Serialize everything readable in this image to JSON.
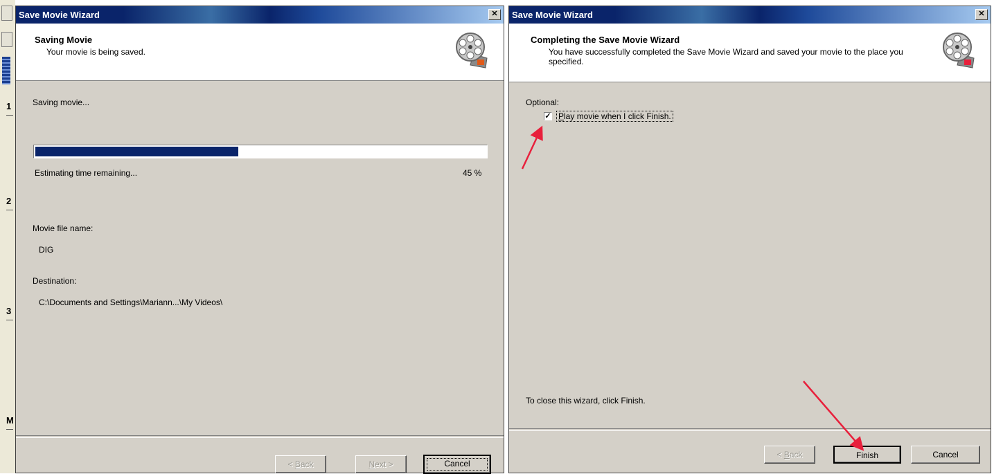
{
  "background_app": {
    "markers": [
      "1",
      "2",
      "3",
      "M"
    ]
  },
  "dialog_saving": {
    "title": "Save Movie Wizard",
    "close_glyph": "✕",
    "header_title": "Saving Movie",
    "header_subtitle": "Your movie is being saved.",
    "status_text": "Saving movie...",
    "progress_fraction": 0.45,
    "estimating_text": "Estimating time remaining...",
    "percent_text": "45 %",
    "file_name_label": "Movie file name:",
    "file_name_value": "DIG",
    "destination_label": "Destination:",
    "destination_value": "C:\\Documents and Settings\\Mariann...\\My Videos\\",
    "buttons": {
      "back_prefix": "< ",
      "back_accel": "B",
      "back_rest": "ack",
      "next_accel": "N",
      "next_rest": "ext >",
      "cancel": "Cancel"
    }
  },
  "dialog_complete": {
    "title": "Save Movie Wizard",
    "close_glyph": "✕",
    "header_title": "Completing the Save Movie Wizard",
    "header_subtitle": "You have successfully completed the Save Movie Wizard and saved your movie to the place you specified.",
    "optional_label": "Optional:",
    "play_checkbox_checked": true,
    "play_checkbox_glyph": "✓",
    "play_label_accel": "P",
    "play_label_rest": "lay movie when I click Finish.",
    "close_hint": "To close this wizard, click Finish.",
    "buttons": {
      "back_prefix": "< ",
      "back_accel": "B",
      "back_rest": "ack",
      "finish": "Finish",
      "cancel": "Cancel"
    }
  },
  "annotations": {
    "arrow_color": "#e8203c"
  },
  "colors": {
    "titlebar": "#0a246a",
    "progress_fill": "#0a246a",
    "dialog_face": "#d4d0c8"
  }
}
